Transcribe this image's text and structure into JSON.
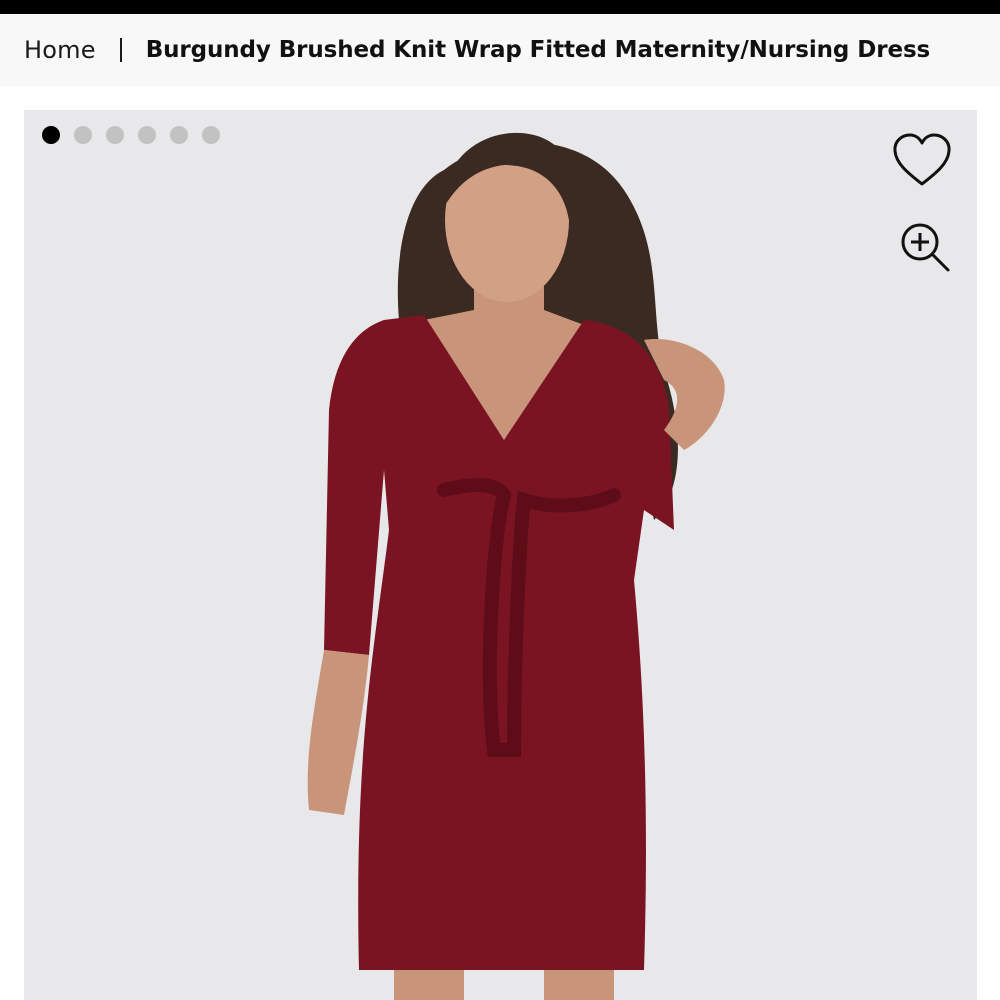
{
  "breadcrumb": {
    "home_label": "Home",
    "current_label": "Burgundy Brushed Knit Wrap Fitted Maternity/Nursing Dress"
  },
  "gallery": {
    "image_count": 6,
    "active_index": 0,
    "icons": {
      "favorite": "heart-icon",
      "zoom": "zoom-in-icon"
    }
  },
  "colors": {
    "dress": "#7b1422",
    "background": "#e8e8ea",
    "active_dot": "#000000",
    "inactive_dot": "#c2c2c2"
  }
}
